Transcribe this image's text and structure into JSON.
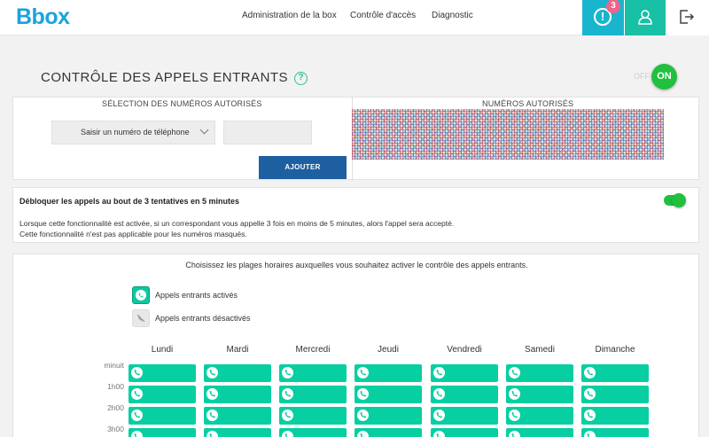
{
  "brand": {
    "logo": "Bbox",
    "accent": "#1aa3de"
  },
  "nav": {
    "items": [
      "Administration de la box",
      "Contrôle d'accès",
      "Diagnostic"
    ],
    "alert_count": "3",
    "alert_symbol": "!"
  },
  "page": {
    "title": "CONTRÔLE DES APPELS ENTRANTS",
    "help": "?",
    "toggle_off": "OFF",
    "toggle_on": "ON"
  },
  "selection": {
    "header": "SÉLECTION DES NUMÉROS AUTORISÉS",
    "select_value": "Saisir un numéro de téléphone",
    "input_value": "",
    "add_label": "AJOUTER"
  },
  "authorized": {
    "header": "NUMÉROS AUTORISÉS"
  },
  "unlock": {
    "title": "Débloquer les appels au bout de 3 tentatives en 5 minutes",
    "desc1": "Lorsque cette fonctionnalité est activée, si un correspondant vous appelle 3 fois en moins de 5 minutes, alors l'appel sera accepté.",
    "desc2": "Cette fonctionnalité n'est pas applicable pour les numéros masqués.",
    "enabled": true
  },
  "schedule": {
    "intro": "Choisissez les plages horaires auxquelles vous souhaitez activer le contrôle des appels entrants.",
    "legend_on": "Appels entrants activés",
    "legend_off": "Appels entrants désactivés",
    "days": [
      "Lundi",
      "Mardi",
      "Mercredi",
      "Jeudi",
      "Vendredi",
      "Samedi",
      "Dimanche"
    ],
    "hours": [
      "minuit",
      "1h00",
      "2h00",
      "3h00"
    ],
    "slot_color": "#07cfa1"
  }
}
